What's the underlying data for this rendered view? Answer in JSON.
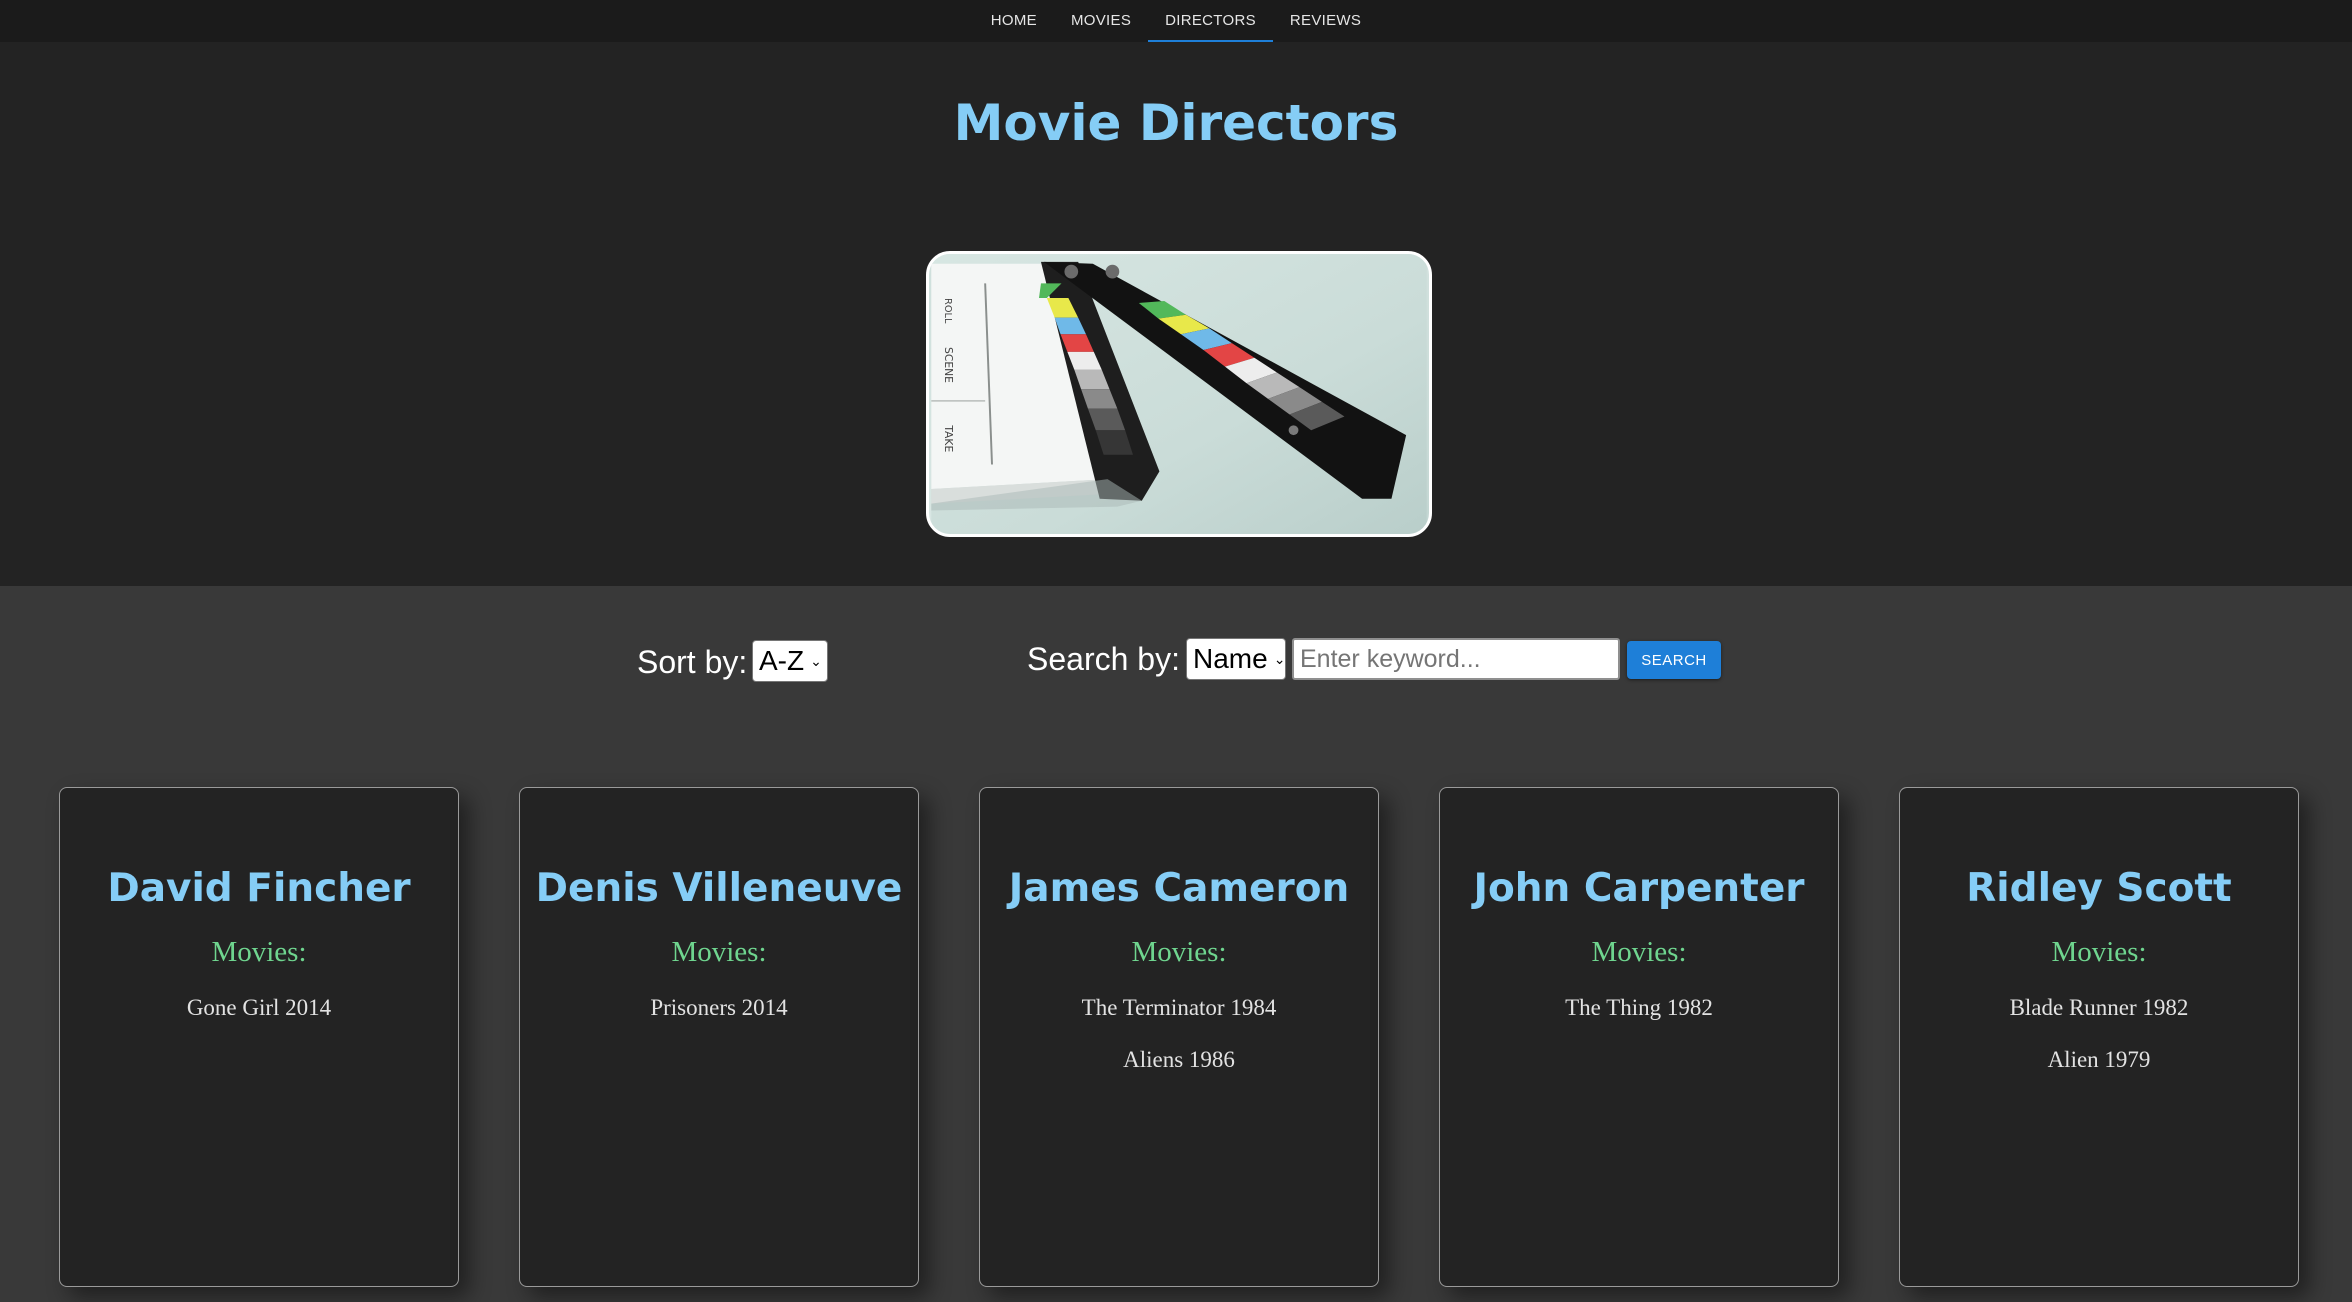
{
  "nav": {
    "items": [
      {
        "label": "HOME",
        "active": false
      },
      {
        "label": "MOVIES",
        "active": false
      },
      {
        "label": "DIRECTORS",
        "active": true
      },
      {
        "label": "REVIEWS",
        "active": false
      }
    ]
  },
  "hero": {
    "title": "Movie Directors",
    "image_alt": "clapperboard-image",
    "clapper_text": [
      "ROLL",
      "SCENE",
      "TAKE"
    ]
  },
  "controls": {
    "sort_label": "Sort by:",
    "sort_value": "A-Z",
    "search_label": "Search by:",
    "search_by_value": "Name",
    "search_placeholder": "Enter keyword...",
    "search_button": "SEARCH"
  },
  "movies_label": "Movies:",
  "directors": [
    {
      "name": "David Fincher",
      "movies": [
        "Gone Girl 2014"
      ]
    },
    {
      "name": "Denis Villeneuve",
      "movies": [
        "Prisoners 2014"
      ]
    },
    {
      "name": "James Cameron",
      "movies": [
        "The Terminator 1984",
        "Aliens 1986"
      ]
    },
    {
      "name": "John Carpenter",
      "movies": [
        "The Thing 1982"
      ]
    },
    {
      "name": "Ridley Scott",
      "movies": [
        "Blade Runner 1982",
        "Alien 1979"
      ]
    }
  ],
  "colors": {
    "accent": "#1e7fd8",
    "title": "#85cdf6",
    "movies_label": "#6fd58f",
    "card_bg": "#232323",
    "page_bg": "#393939"
  }
}
